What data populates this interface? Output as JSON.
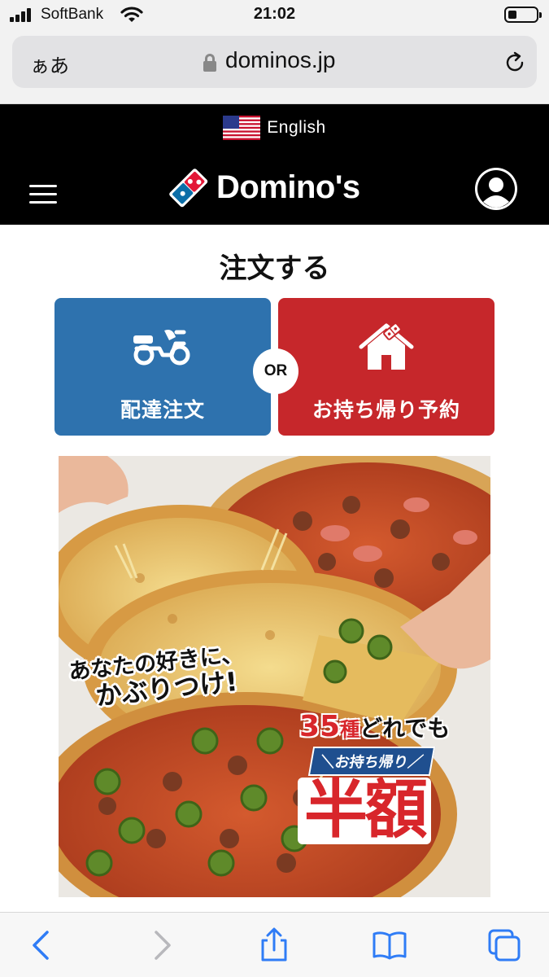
{
  "status_bar": {
    "carrier": "SoftBank",
    "time": "21:02",
    "battery_level": 0.3
  },
  "browser": {
    "text_size_button": "ぁあ",
    "domain": "dominos.jp"
  },
  "header": {
    "language_label": "English",
    "brand_name": "Domino's",
    "colors": {
      "background": "#000000",
      "logo_red": "#e31837",
      "logo_blue": "#006491"
    }
  },
  "order": {
    "title": "注文する",
    "delivery_label": "配達注文",
    "or_label": "OR",
    "takeout_label": "お持ち帰り予約",
    "colors": {
      "delivery": "#2e72ae",
      "takeout": "#c6272b"
    }
  },
  "promo": {
    "tagline_line1": "あなたの好きに、",
    "tagline_line2": "かぶりつけ!",
    "count_number": "35",
    "count_unit": "種",
    "count_suffix": "どれでも",
    "tag": "＼お持ち帰り／",
    "discount": "半額"
  },
  "icons": {
    "signal": "signal-icon",
    "wifi": "wifi-icon",
    "lock": "lock-icon",
    "reload": "reload-icon",
    "menu": "hamburger-icon",
    "account": "account-icon",
    "scooter": "scooter-icon",
    "house": "house-icon",
    "back": "chevron-left-icon",
    "forward": "chevron-right-icon",
    "share": "share-icon",
    "bookmarks": "book-icon",
    "tabs": "tabs-icon"
  }
}
